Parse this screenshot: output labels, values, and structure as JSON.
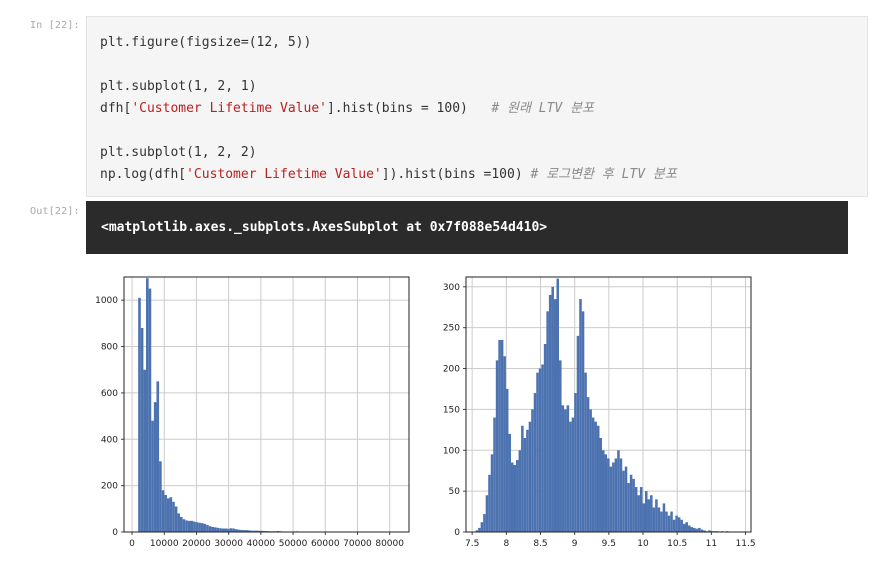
{
  "cell": {
    "in_prompt": "In [22]:",
    "out_prompt": "Out[22]:",
    "code": {
      "l1": "plt.figure(figsize=(12, 5))",
      "l2": "plt.subplot(1, 2, 1)",
      "l3_pre": "dfh[",
      "l3_str": "'Customer Lifetime Value'",
      "l3_post": "].hist(bins = 100)",
      "l3_cmt": "# 원래 LTV 분포",
      "l4": "plt.subplot(1, 2, 2)",
      "l5_pre": "np.log(dfh[",
      "l5_str": "'Customer Lifetime Value'",
      "l5_post": "]).hist(bins =100)",
      "l5_cmt": "# 로그변환 후 LTV 분포"
    },
    "output_text": "<matplotlib.axes._subplots.AxesSubplot at 0x7f088e54d410>"
  },
  "colors": {
    "bar": "#4c72b0",
    "grid": "#cccccc"
  },
  "chart_data": [
    {
      "type": "bar",
      "title": "",
      "xlabel": "",
      "ylabel": "",
      "xlim": [
        -2500,
        86000
      ],
      "ylim": [
        0,
        1100
      ],
      "grid": true,
      "xticks": [
        0,
        10000,
        20000,
        30000,
        40000,
        50000,
        60000,
        70000,
        80000
      ],
      "yticks": [
        0,
        200,
        400,
        600,
        800,
        1000
      ],
      "bin_start": 1900,
      "bin_width": 812,
      "values": [
        1010,
        880,
        700,
        1095,
        1050,
        480,
        560,
        650,
        305,
        180,
        160,
        145,
        150,
        130,
        110,
        80,
        65,
        55,
        50,
        48,
        48,
        45,
        42,
        40,
        38,
        35,
        30,
        25,
        22,
        20,
        18,
        16,
        15,
        15,
        14,
        16,
        15,
        12,
        10,
        9,
        8,
        8,
        7,
        6,
        6,
        6,
        5,
        5,
        4,
        4,
        3,
        3,
        3,
        4,
        3,
        2,
        2,
        2,
        2,
        2,
        3,
        2,
        2,
        1,
        1,
        1,
        1,
        1,
        1,
        1,
        1,
        1,
        1,
        1,
        1,
        1,
        1,
        1,
        1,
        1,
        1,
        0,
        0,
        0,
        0,
        0,
        0,
        0,
        0,
        0,
        0,
        0,
        0,
        0,
        0,
        0,
        0,
        0,
        0,
        0
      ]
    },
    {
      "type": "bar",
      "title": "",
      "xlabel": "",
      "ylabel": "",
      "xlim": [
        7.41,
        11.58
      ],
      "ylim": [
        0,
        312
      ],
      "grid": true,
      "xticks": [
        7.5,
        8.0,
        8.5,
        9.0,
        9.5,
        10.0,
        10.5,
        11.0,
        11.5
      ],
      "yticks": [
        0,
        50,
        100,
        150,
        200,
        250,
        300
      ],
      "bin_start": 7.55,
      "bin_width": 0.037,
      "values": [
        2,
        5,
        12,
        22,
        45,
        70,
        95,
        140,
        210,
        235,
        235,
        215,
        175,
        120,
        85,
        82,
        88,
        100,
        130,
        115,
        125,
        135,
        150,
        170,
        195,
        200,
        205,
        230,
        270,
        290,
        300,
        285,
        310,
        210,
        155,
        150,
        155,
        135,
        140,
        170,
        240,
        285,
        270,
        195,
        165,
        150,
        140,
        135,
        130,
        115,
        100,
        95,
        90,
        80,
        85,
        90,
        100,
        90,
        75,
        80,
        60,
        70,
        65,
        55,
        45,
        55,
        35,
        50,
        40,
        45,
        30,
        40,
        30,
        25,
        35,
        25,
        20,
        25,
        15,
        20,
        18,
        15,
        10,
        12,
        8,
        6,
        5,
        4,
        5,
        3,
        2,
        1,
        2,
        1,
        1,
        1,
        0,
        1,
        0,
        1
      ]
    }
  ]
}
